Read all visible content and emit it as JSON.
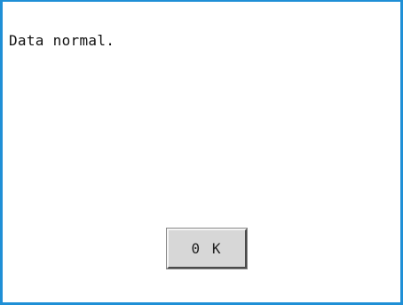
{
  "dialog": {
    "message": "Data normal.",
    "ok_label": "0 K"
  },
  "colors": {
    "frame": "#1f8fd6",
    "button_face": "#d7d7d7",
    "text": "#111111"
  }
}
